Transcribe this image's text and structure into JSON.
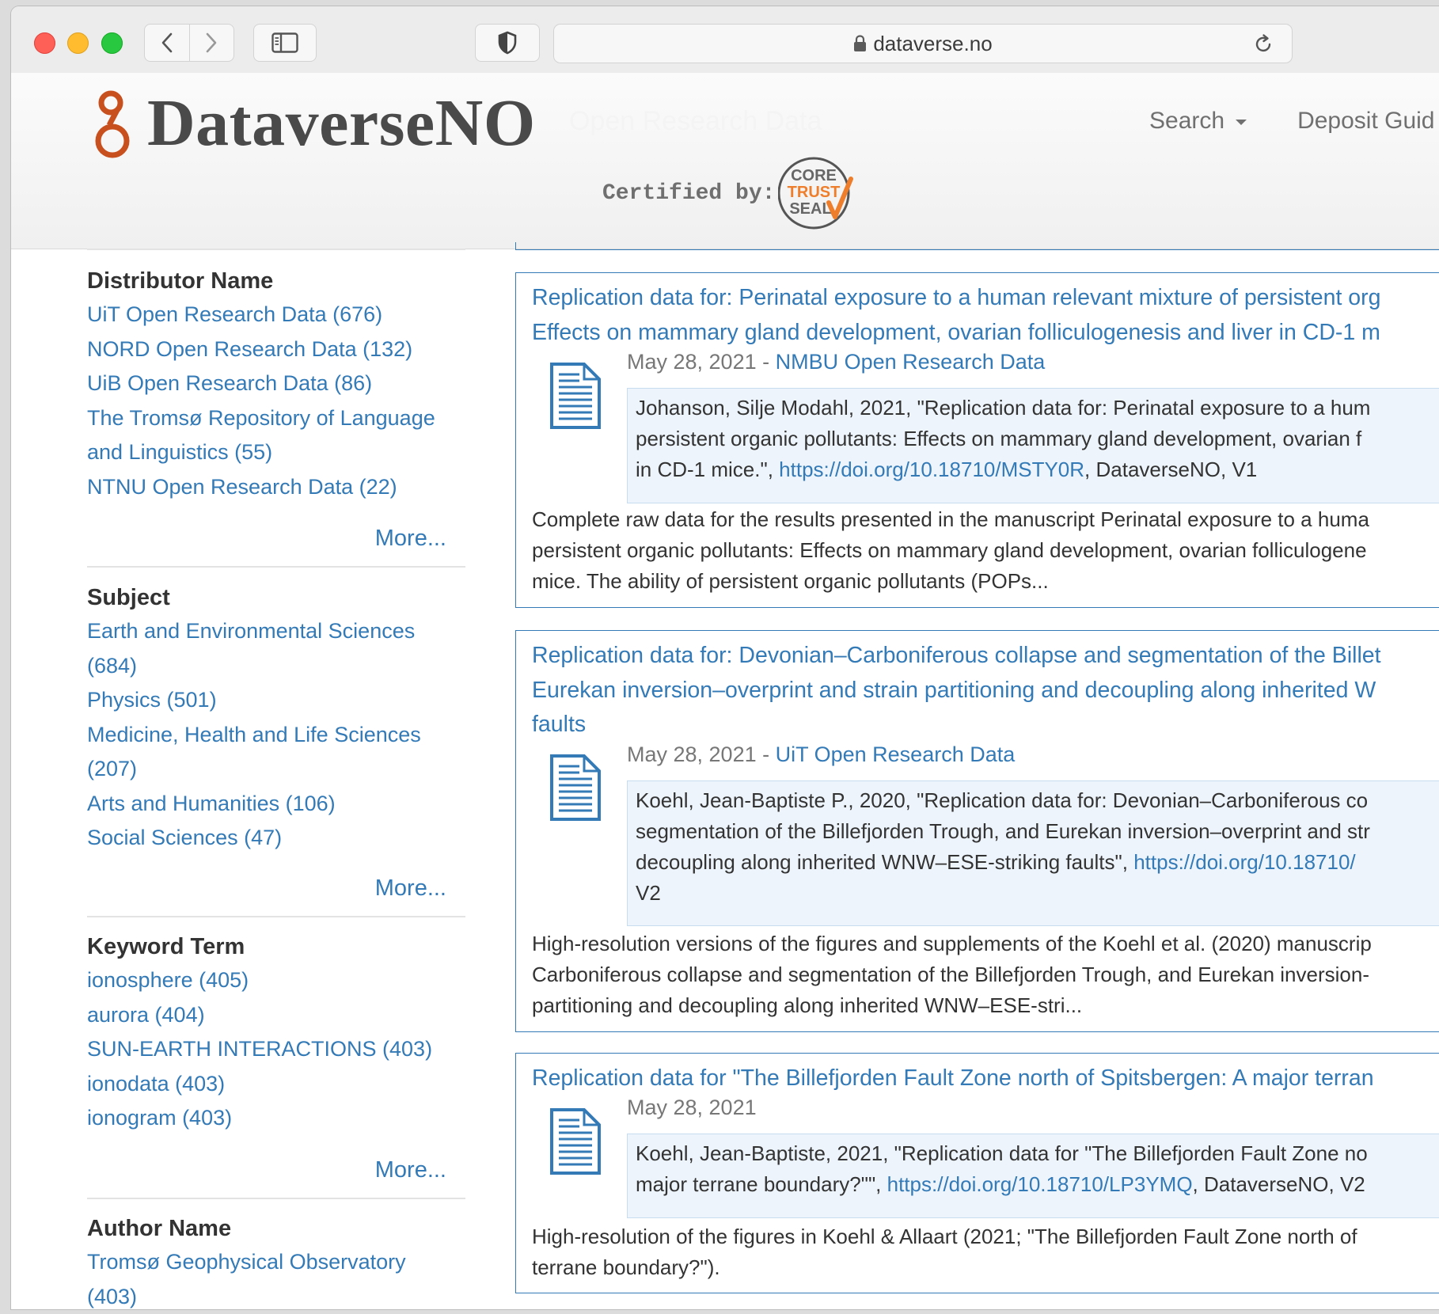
{
  "browser": {
    "url": "dataverse.no"
  },
  "header": {
    "logo": "DataverseNO",
    "tagline": "Open Research Data",
    "nav": [
      "Search",
      "Deposit Guid"
    ],
    "certified_label": "Certified by:",
    "seal_lines": [
      "CORE",
      "TRUST",
      "SEAL"
    ]
  },
  "facets": {
    "distributor": {
      "title": "Distributor Name",
      "items": [
        "UiT Open Research Data (676)",
        "NORD Open Research Data (132)",
        "UiB Open Research Data (86)",
        "The Tromsø Repository of Language",
        "and Linguistics (55)",
        "NTNU Open Research Data (22)"
      ],
      "more": "More..."
    },
    "subject": {
      "title": "Subject",
      "items": [
        "Earth and Environmental Sciences",
        "(684)",
        "Physics (501)",
        "Medicine, Health and Life Sciences",
        "(207)",
        "Arts and Humanities (106)",
        "Social Sciences (47)"
      ],
      "more": "More..."
    },
    "keyword": {
      "title": "Keyword Term",
      "items": [
        "ionosphere (405)",
        "aurora (404)",
        "SUN-EARTH INTERACTIONS (403)",
        "ionodata (403)",
        "ionogram (403)"
      ],
      "more": "More..."
    },
    "author": {
      "title": "Author Name",
      "items": [
        "Tromsø Geophysical Observatory",
        "(403)"
      ]
    }
  },
  "results": [
    {
      "title_lines": [
        "Replication data for: Perinatal exposure to a human relevant mixture of persistent org",
        "Effects on mammary gland development, ovarian folliculogenesis and liver in CD-1 m"
      ],
      "date": "May 28, 2021",
      "date_sep": " - ",
      "publisher": "NMBU Open Research Data",
      "citation": [
        {
          "text": "Johanson, Silje Modahl, 2021, \"Replication data for: Perinatal exposure to a hum",
          "doi": "",
          "after": ""
        },
        {
          "text": "persistent organic pollutants: Effects on mammary gland development, ovarian f",
          "doi": "",
          "after": ""
        },
        {
          "text": "in CD-1 mice.\", ",
          "doi": "https://doi.org/10.18710/MSTY0R",
          "after": ", DataverseNO, V1"
        }
      ],
      "description": [
        "Complete raw data for the results presented in the manuscript Perinatal exposure to a huma",
        "persistent organic pollutants: Effects on mammary gland development, ovarian folliculogene",
        "mice. The ability of persistent organic pollutants (POPs..."
      ]
    },
    {
      "title_lines": [
        "Replication data for: Devonian–Carboniferous collapse and segmentation of the Billet",
        "Eurekan inversion–overprint and strain partitioning and decoupling along inherited W",
        "faults"
      ],
      "date": "May 28, 2021",
      "date_sep": " - ",
      "publisher": "UiT Open Research Data",
      "citation": [
        {
          "text": "Koehl, Jean-Baptiste P., 2020, \"Replication data for: Devonian–Carboniferous co",
          "doi": "",
          "after": ""
        },
        {
          "text": "segmentation of the Billefjorden Trough, and Eurekan inversion–overprint and str",
          "doi": "",
          "after": ""
        },
        {
          "text": "decoupling along inherited WNW–ESE-striking faults\", ",
          "doi": "https://doi.org/10.18710/",
          "after": ""
        },
        {
          "text": "V2",
          "doi": "",
          "after": ""
        }
      ],
      "description": [
        "High-resolution versions of the figures and supplements of the Koehl et al. (2020) manuscrip",
        "Carboniferous collapse and segmentation of the Billefjorden Trough, and Eurekan inversion-",
        "partitioning and decoupling along inherited WNW–ESE-stri..."
      ]
    },
    {
      "title_lines": [
        "Replication data for \"The Billefjorden Fault Zone north of Spitsbergen: A major terran"
      ],
      "date": "May 28, 2021",
      "date_sep": "",
      "publisher": "",
      "citation": [
        {
          "text": "Koehl, Jean-Baptiste, 2021, \"Replication data for \"The Billefjorden Fault Zone no",
          "doi": "",
          "after": ""
        },
        {
          "text": "major terrane boundary?\"\", ",
          "doi": "https://doi.org/10.18710/LP3YMQ",
          "after": ", DataverseNO, V2"
        }
      ],
      "description": [
        "High-resolution of the figures in Koehl & Allaart (2021; \"The Billefjorden Fault Zone north of",
        "terrane boundary?\")."
      ]
    }
  ],
  "colors": {
    "link": "#337ab7",
    "citation_bg": "#edf4fb",
    "logo_accent": "#c8501e"
  },
  "icons": [
    "lock-icon",
    "reload-icon",
    "back-chevron-icon",
    "forward-chevron-icon",
    "sidebar-icon",
    "shield-icon",
    "document-icon",
    "dropdown-caret-icon"
  ]
}
